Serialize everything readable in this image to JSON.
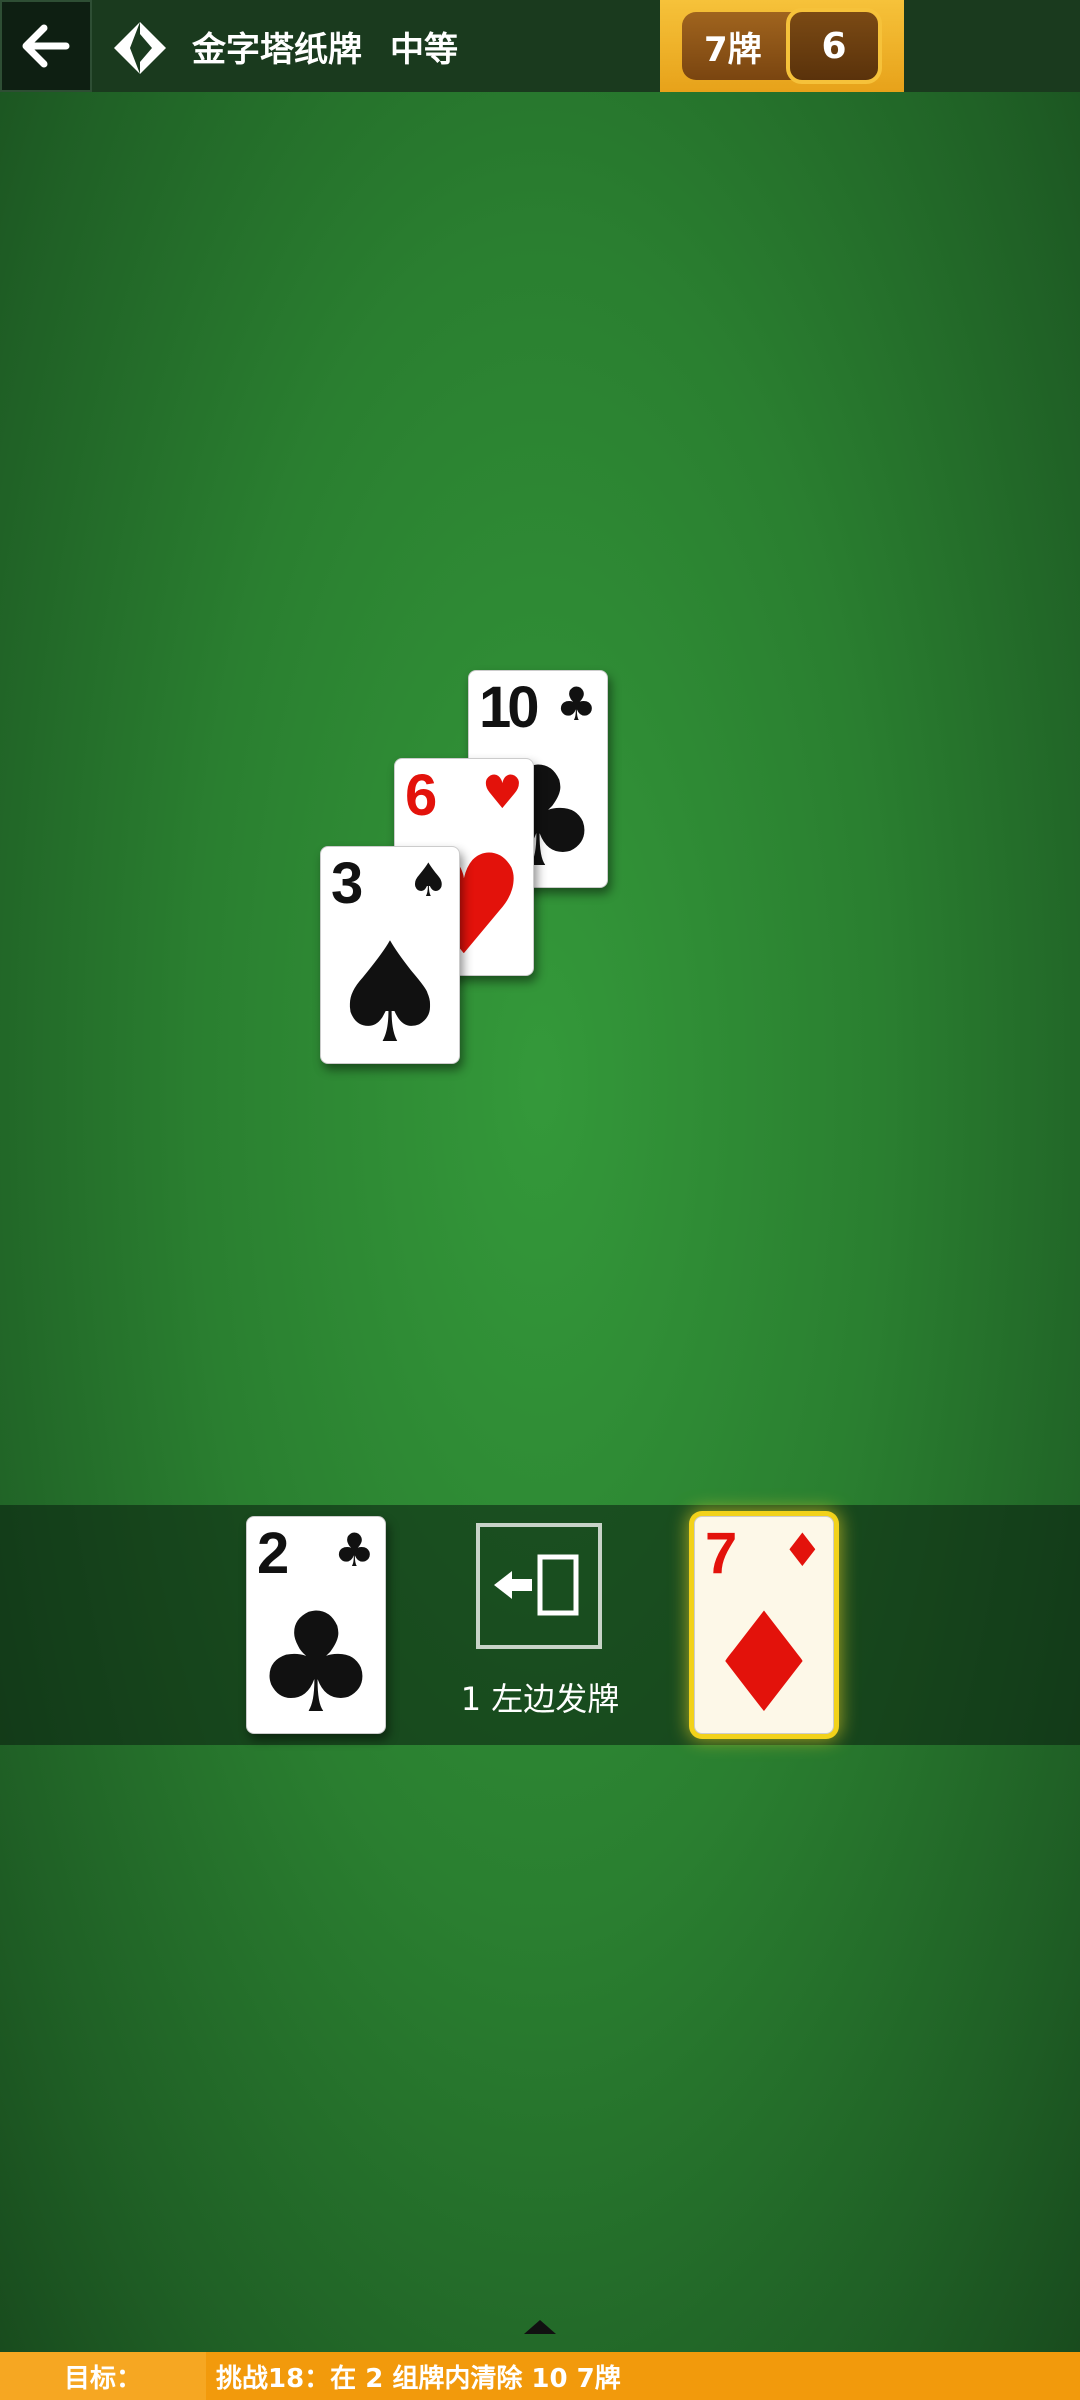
{
  "header": {
    "back_icon": "arrow-left-icon",
    "game_icon": "pyramid-icon",
    "title": "金字塔纸牌",
    "difficulty": "中等",
    "score_label": "7牌",
    "score_value": "6"
  },
  "pyramid": [
    {
      "rank": "10",
      "suit": "♣",
      "color": "black"
    },
    {
      "rank": "6",
      "suit": "♥",
      "color": "red"
    },
    {
      "rank": "3",
      "suit": "♠",
      "color": "black"
    }
  ],
  "stock": {
    "left_card": {
      "rank": "2",
      "suit": "♣",
      "color": "black"
    },
    "deal_icon": "deal-left-icon",
    "deal_text": "1 左边发牌",
    "right_card": {
      "rank": "7",
      "suit": "♦",
      "color": "red",
      "highlighted": true
    }
  },
  "footer": {
    "goal_label": "目标：",
    "goal_text": "挑战18：在 2 组牌内清除 10 7牌",
    "toggle_icon": "caret-up-icon"
  },
  "colors": {
    "felt": "#2a7f30",
    "gold": "#f6c23a",
    "goal_bar": "#f29a0c",
    "red_suit": "#e3120b"
  }
}
